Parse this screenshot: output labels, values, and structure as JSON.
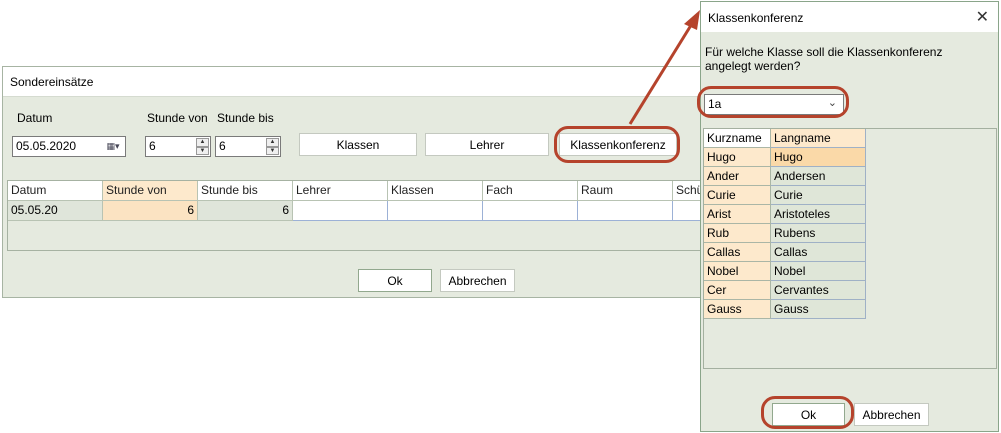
{
  "main_window": {
    "title": "Sondereinsätze",
    "labels": {
      "datum": "Datum",
      "stunde_von": "Stunde von",
      "stunde_bis": "Stunde bis"
    },
    "date_value": "05.05.2020",
    "stunde_von_value": "6",
    "stunde_bis_value": "6",
    "buttons": {
      "klassen": "Klassen",
      "lehrer": "Lehrer",
      "klassenkonferenz": "Klassenkonferenz",
      "ok": "Ok",
      "abbrechen": "Abbrechen"
    },
    "grid": {
      "columns": [
        "Datum",
        "Stunde von",
        "Stunde bis",
        "Lehrer",
        "Klassen",
        "Fach",
        "Raum",
        "Schü"
      ],
      "rows": [
        {
          "datum": "05.05.20",
          "stunde_von": "6",
          "stunde_bis": "6",
          "lehrer": "",
          "klassen": "",
          "fach": "",
          "raum": "",
          "schue": ""
        }
      ]
    }
  },
  "dialog": {
    "title": "Klassenkonferenz",
    "close_glyph": "✕",
    "question": "Für welche Klasse soll die Klassenkonferenz angelegt werden?",
    "selected_class": "1a",
    "table": {
      "columns": [
        "Kurzname",
        "Langname"
      ],
      "rows": [
        [
          "Hugo",
          "Hugo"
        ],
        [
          "Ander",
          "Andersen"
        ],
        [
          "Curie",
          "Curie"
        ],
        [
          "Arist",
          "Aristoteles"
        ],
        [
          "Rub",
          "Rubens"
        ],
        [
          "Callas",
          "Callas"
        ],
        [
          "Nobel",
          "Nobel"
        ],
        [
          "Cer",
          "Cervantes"
        ],
        [
          "Gauss",
          "Gauss"
        ]
      ]
    },
    "buttons": {
      "ok": "Ok",
      "abbrechen": "Abbrechen"
    }
  },
  "colors": {
    "annotation": "#b5432c",
    "window_bg": "#e5eadf",
    "header_highlight": "#fde9cc"
  },
  "icons": {
    "date_picker": "calendar-icon",
    "dropdown": "chevron-down-icon",
    "close": "close-icon"
  }
}
